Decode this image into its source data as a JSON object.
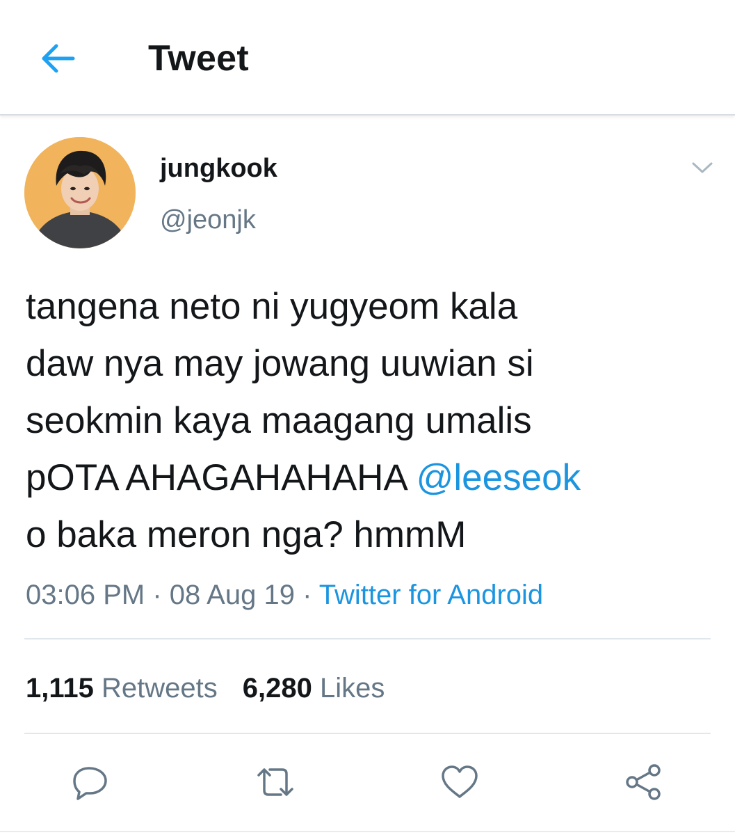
{
  "header": {
    "title": "Tweet",
    "back_icon": "arrow-left-icon",
    "accent_color": "#1da1f2"
  },
  "author": {
    "display_name": "jungkook",
    "handle": "@jeonjk",
    "avatar_icon": "avatar-photo",
    "more_icon": "chevron-down-icon"
  },
  "tweet": {
    "lines": [
      "tangena neto ni yugyeom kala",
      "daw nya may jowang uuwian si",
      "seokmin kaya maagang umalis"
    ],
    "line4_text": "pOTA AHAGAHAHAHA ",
    "mention": "@leeseok",
    "line5": "o baka meron nga? hmmM",
    "mention_color": "#1b95e0"
  },
  "meta": {
    "time": "03:06 PM",
    "separator": " · ",
    "date": "08 Aug 19",
    "source": "Twitter for Android"
  },
  "stats": {
    "retweets_count": "1,115",
    "retweets_label": " Retweets",
    "likes_count": "6,280",
    "likes_label": " Likes"
  },
  "actions": {
    "reply_icon": "reply-icon",
    "retweet_icon": "retweet-icon",
    "like_icon": "heart-icon",
    "share_icon": "share-icon",
    "icon_color": "#657786"
  }
}
